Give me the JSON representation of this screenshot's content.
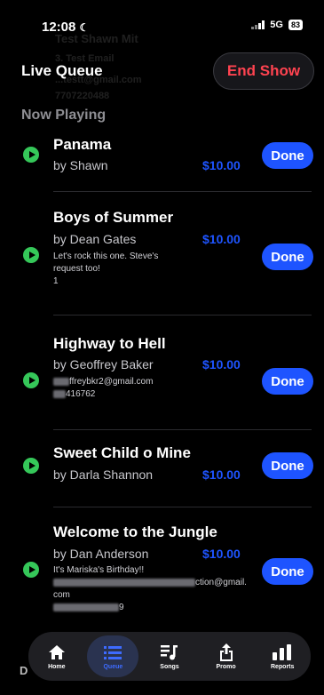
{
  "status": {
    "time": "12:08",
    "network": "5G",
    "battery": "83"
  },
  "header": {
    "title": "Live Queue",
    "end_show_label": "End Show"
  },
  "background_ghost": {
    "line1": "Test Shawn Mit",
    "line2": "3. Test Email",
    "line3": "...testt@gmail.com",
    "line4": "7707220488"
  },
  "section": {
    "title": "Now Playing"
  },
  "queue": [
    {
      "title": "Panama",
      "artist": "by Shawn",
      "price": "$10.00",
      "done_label": "Done"
    },
    {
      "title": "Boys of Summer",
      "artist": "by Dean Gates",
      "price": "$10.00",
      "done_label": "Done",
      "note_line1": "Let's rock this one. Steve's",
      "note_line2": "request too!",
      "note_line3": "1"
    },
    {
      "title": "Highway to Hell",
      "artist": "by Geoffrey Baker",
      "price": "$10.00",
      "done_label": "Done",
      "email_visible": "ffreybkr2@gmail.com",
      "phone_visible": "416762"
    },
    {
      "title": "Sweet Child o Mine",
      "artist": "by Darla Shannon",
      "price": "$10.00",
      "done_label": "Done"
    },
    {
      "title": "Welcome to the Jungle",
      "artist": "by Dan Anderson",
      "price": "$10.00",
      "done_label": "Done",
      "note_line1": "It's Mariska's Birthday!!",
      "email_visible": "ction@gmail.",
      "email_line2": "com",
      "phone_visible": "9"
    }
  ],
  "tabs": [
    {
      "label": "Home",
      "icon": "home-icon",
      "active": false
    },
    {
      "label": "Queue",
      "icon": "list-icon",
      "active": true
    },
    {
      "label": "Songs",
      "icon": "music-list-icon",
      "active": false
    },
    {
      "label": "Promo",
      "icon": "share-icon",
      "active": false
    },
    {
      "label": "Reports",
      "icon": "bar-chart-icon",
      "active": false
    }
  ],
  "colors": {
    "accent": "#1e54ff",
    "danger": "#ff4350",
    "play": "#35c759",
    "background": "#000000"
  }
}
